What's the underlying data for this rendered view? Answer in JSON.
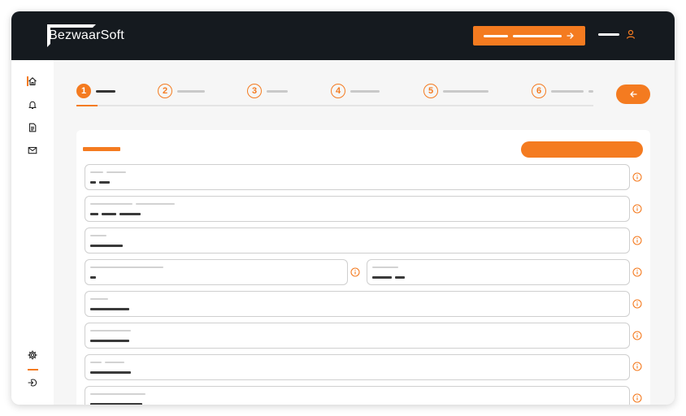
{
  "app": {
    "brand": "BezwaarSoft",
    "accent_color": "#f47b20",
    "topbar_color": "#151a1f"
  },
  "header": {
    "cta_icon": "arrow-right-icon",
    "user_icon": "user-icon"
  },
  "sidebar": {
    "items": [
      {
        "icon": "home-icon",
        "active": true
      },
      {
        "icon": "bell-icon"
      },
      {
        "icon": "document-icon"
      },
      {
        "icon": "mail-icon"
      }
    ],
    "bottom_items": [
      {
        "icon": "gear-icon"
      },
      {
        "icon": "logout-icon"
      }
    ]
  },
  "stepper": {
    "steps": [
      {
        "number": "1",
        "active": true
      },
      {
        "number": "2"
      },
      {
        "number": "3"
      },
      {
        "number": "4"
      },
      {
        "number": "5"
      },
      {
        "number": "6"
      }
    ],
    "back_icon": "arrow-left-icon"
  },
  "form": {
    "info_icon": "info-icon"
  }
}
